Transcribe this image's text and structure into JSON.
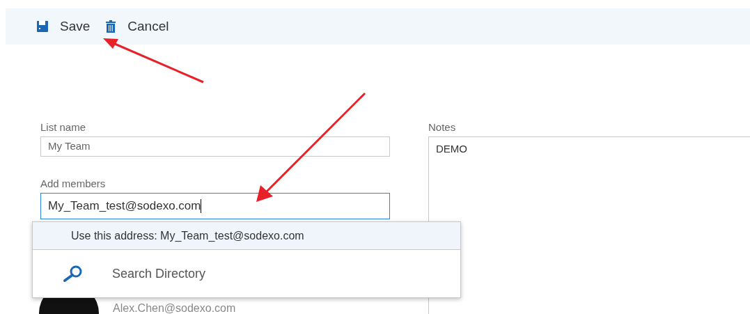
{
  "toolbar": {
    "buttons": [
      {
        "kind": "save",
        "label": "Save"
      },
      {
        "kind": "cancel",
        "label": "Cancel"
      }
    ]
  },
  "form": {
    "list_name": {
      "label": "List name",
      "value": "My Team"
    },
    "add_members": {
      "label": "Add members",
      "value": "My_Team_test@sodexo.com",
      "focused": true
    },
    "notes": {
      "label": "Notes",
      "value": "DEMO"
    }
  },
  "suggestions": [
    {
      "kind": "address",
      "label": "Use this address: My_Team_test@sodexo.com",
      "selected": true
    },
    {
      "kind": "search",
      "label": "Search Directory",
      "selected": false
    }
  ],
  "members": [
    {
      "email": "Alex.Chen@sodexo.com"
    }
  ]
}
